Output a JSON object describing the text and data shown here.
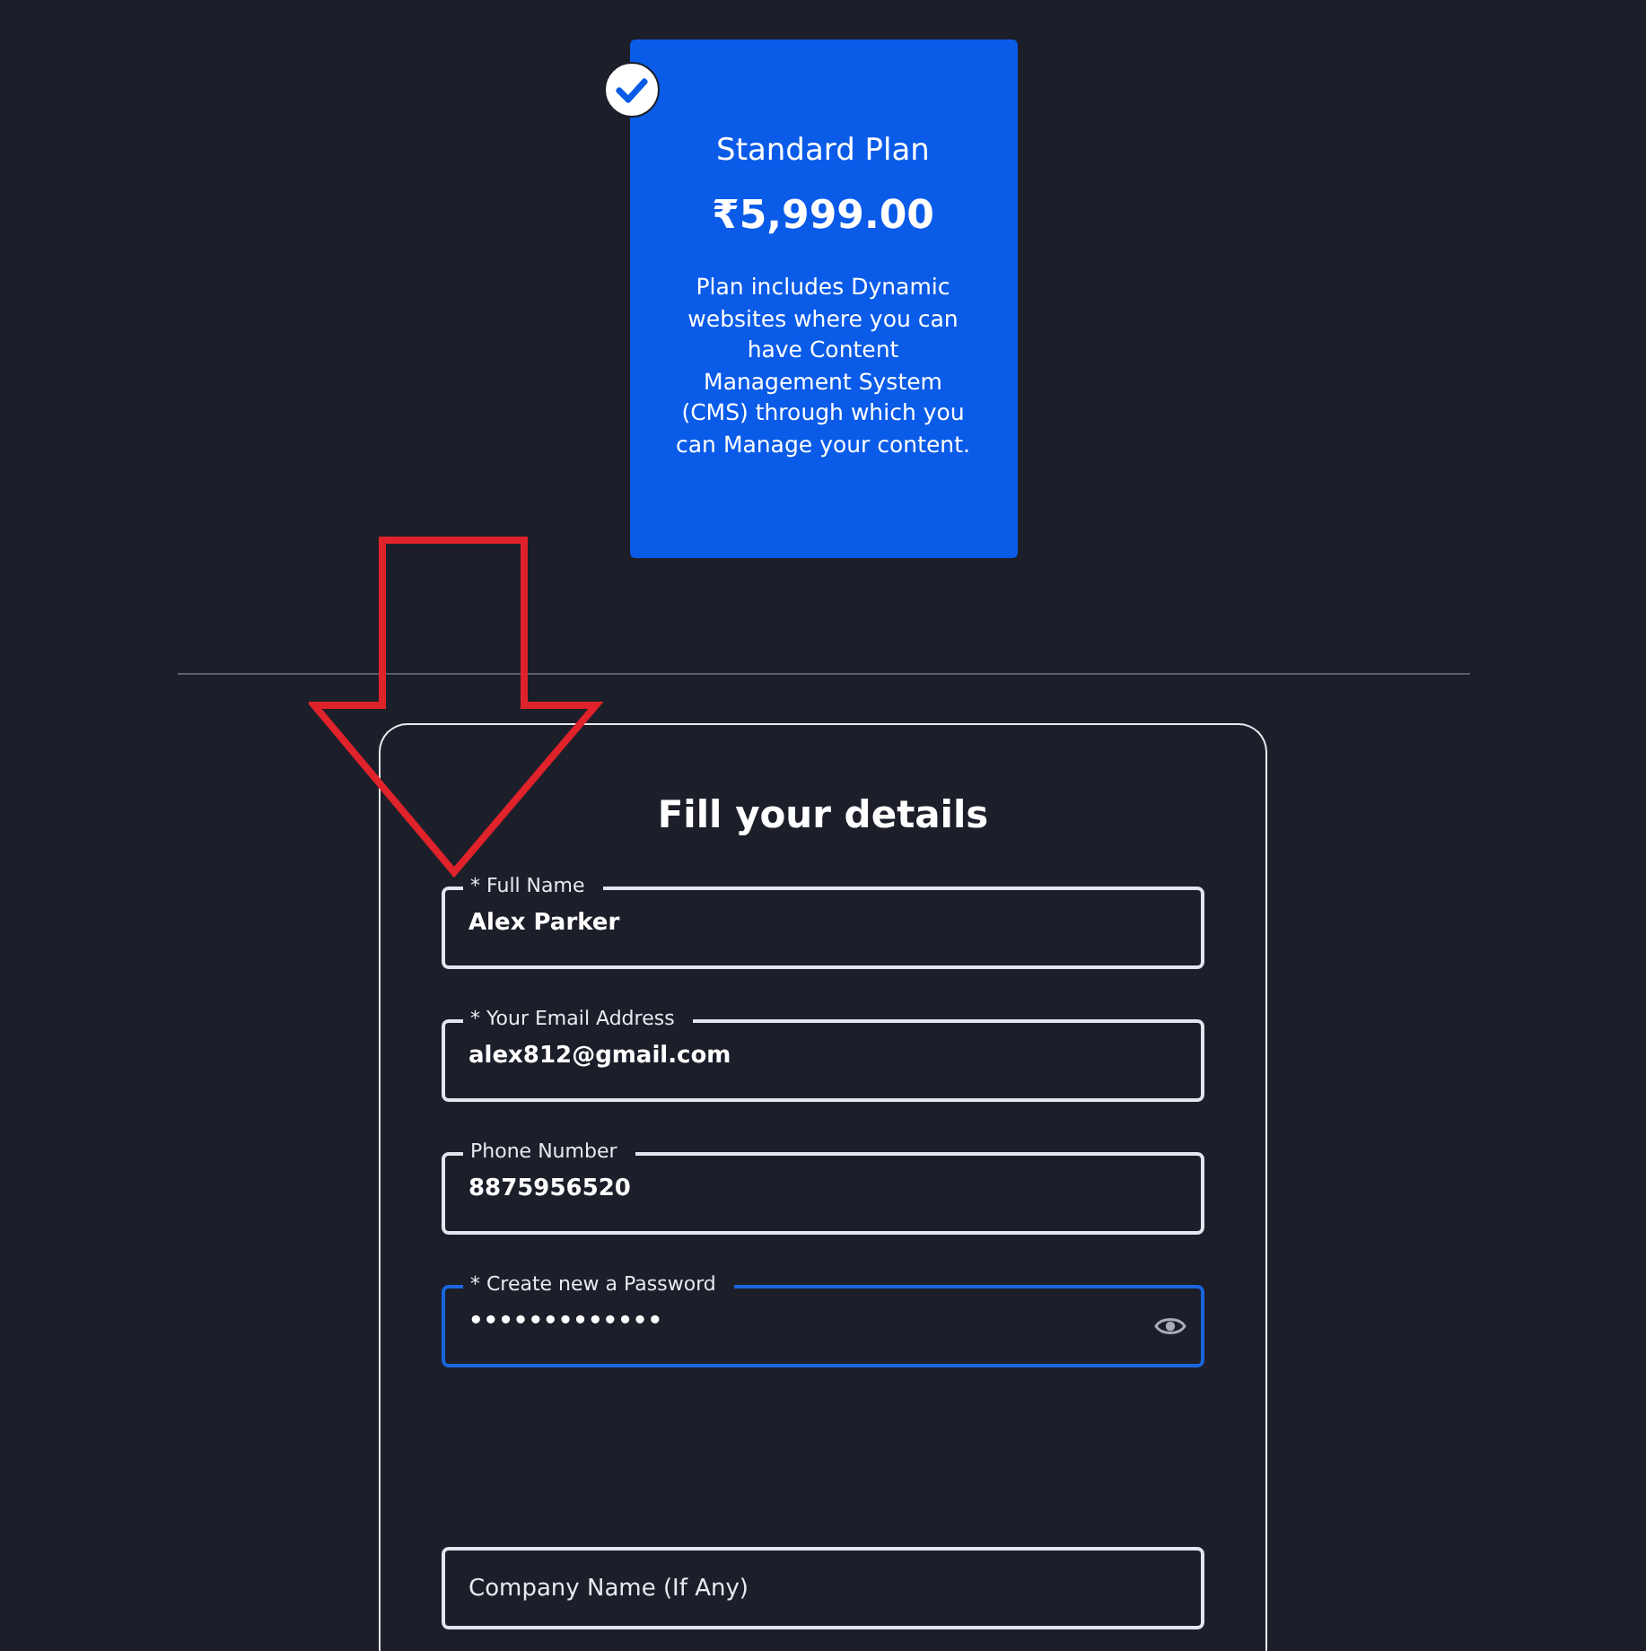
{
  "plan_card": {
    "selected": true,
    "title": "Standard Plan",
    "price": "₹5,999.00",
    "description": "Plan includes Dynamic websites where you can have Content Management System (CMS) through which you can Manage your content."
  },
  "form": {
    "title": "Fill your details",
    "fields": [
      {
        "label": "* Full Name",
        "value": "Alex Parker",
        "focused": false
      },
      {
        "label": "* Your Email Address",
        "value": "alex812@gmail.com",
        "focused": false
      },
      {
        "label": "Phone Number",
        "value": "8875956520",
        "focused": false
      },
      {
        "label": "* Create new a Password",
        "value": "•••••••••••••",
        "focused": true,
        "kind": "password"
      },
      {
        "placeholder": "Company Name (If Any)",
        "focused": false
      }
    ]
  }
}
